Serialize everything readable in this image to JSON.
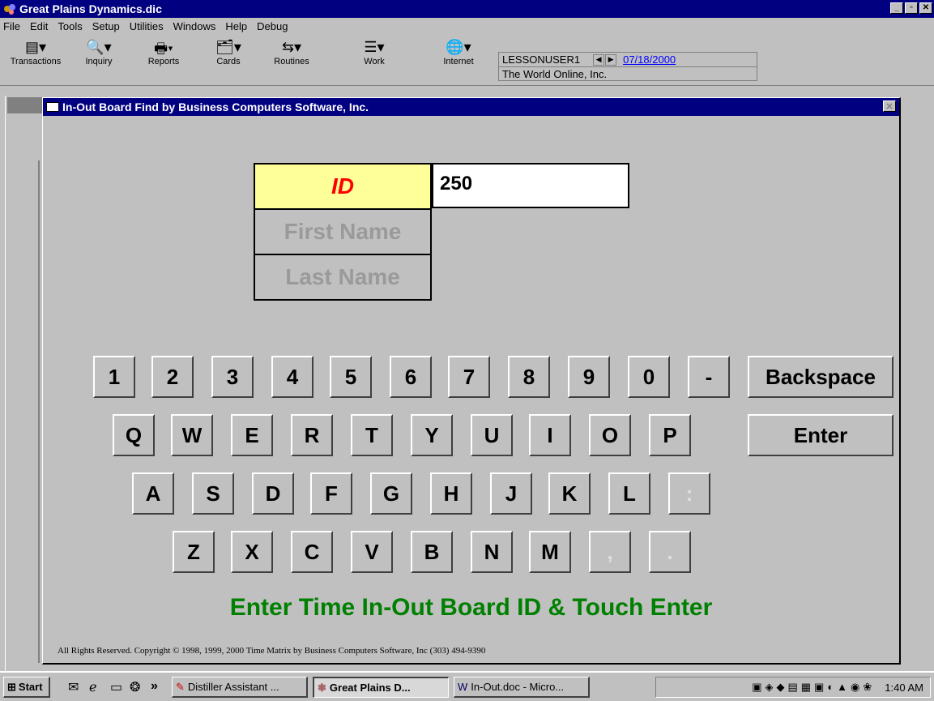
{
  "app": {
    "title": "Great Plains Dynamics.dic",
    "window_buttons": [
      "_",
      "▫",
      "✕"
    ]
  },
  "menu": [
    "File",
    "Edit",
    "Tools",
    "Setup",
    "Utilities",
    "Windows",
    "Help",
    "Debug"
  ],
  "toolbar": [
    {
      "label": "Transactions",
      "icon": "transactions-icon"
    },
    {
      "label": "Inquiry",
      "icon": "inquiry-icon"
    },
    {
      "label": "Reports",
      "icon": "reports-icon"
    },
    {
      "label": "Cards",
      "icon": "cards-icon"
    },
    {
      "label": "Routines",
      "icon": "routines-icon"
    },
    {
      "label": "Work",
      "icon": "work-icon"
    },
    {
      "label": "Internet",
      "icon": "globe-icon"
    }
  ],
  "user_info": {
    "user": "LESSONUSER1",
    "date": "07/18/2000",
    "company": "The World Online, Inc."
  },
  "dialog": {
    "title": "In-Out Board Find by Business Computers Software, Inc.",
    "fields": {
      "id_label": "ID",
      "first_name_label": "First Name",
      "last_name_label": "Last Name",
      "id_value": "250"
    },
    "keypad": {
      "row1": [
        "1",
        "2",
        "3",
        "4",
        "5",
        "6",
        "7",
        "8",
        "9",
        "0",
        "-"
      ],
      "backspace": "Backspace",
      "row2": [
        "Q",
        "W",
        "E",
        "R",
        "T",
        "Y",
        "U",
        "I",
        "O",
        "P"
      ],
      "enter": "Enter",
      "row3": [
        "A",
        "S",
        "D",
        "F",
        "G",
        "H",
        "J",
        "K",
        "L",
        ":"
      ],
      "row4": [
        "Z",
        "X",
        "C",
        "V",
        "B",
        "N",
        "M",
        ",",
        "."
      ]
    },
    "prompt": "Enter Time In-Out Board ID & Touch Enter",
    "copyright": "All Rights Reserved. Copyright © 1998, 1999, 2000 Time Matrix by Business Computers Software, Inc (303) 494-9390"
  },
  "taskbar": {
    "start": "Start",
    "buttons": [
      {
        "label": "Distiller Assistant ..."
      },
      {
        "label": "Great Plains D..."
      },
      {
        "label": "In-Out.doc - Micro..."
      }
    ],
    "overflow": "»",
    "time": "1:40 AM"
  },
  "colors": {
    "titlebar": "#000080",
    "id_highlight": "#ffff99",
    "id_label": "#ff0000",
    "prompt": "#008000"
  }
}
